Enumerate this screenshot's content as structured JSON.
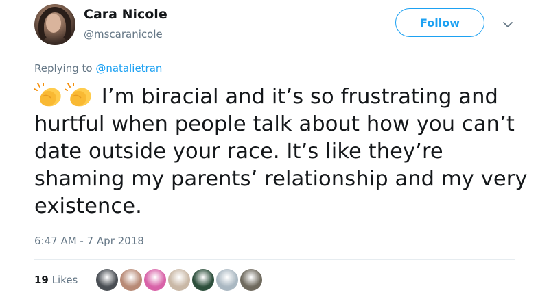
{
  "author": {
    "display_name": "Cara Nicole",
    "handle": "@mscaranicole",
    "avatar_icon": "profile-photo"
  },
  "follow_label": "Follow",
  "caret_icon": "chevron-down-icon",
  "reply": {
    "prefix": "Replying to ",
    "to_handle": "@natalietran"
  },
  "tweet": {
    "emoji": [
      "clapping-hands-emoji",
      "clapping-hands-emoji"
    ],
    "text": "I’m biracial and it’s so frustrating and hurtful when people talk about how you can’t date outside your race. It’s like they’re shaming my parents’ relationship and my very existence."
  },
  "timestamp": "6:47 AM - 7 Apr 2018",
  "likes": {
    "count": "19",
    "label": "Likes"
  },
  "likers": [
    {
      "name": "liker-avatar-1",
      "color": "#4a4f55"
    },
    {
      "name": "liker-avatar-2",
      "color": "#b88a76"
    },
    {
      "name": "liker-avatar-3",
      "color": "#d862a8"
    },
    {
      "name": "liker-avatar-4",
      "color": "#c9b8a6"
    },
    {
      "name": "liker-avatar-5",
      "color": "#2d4f3c"
    },
    {
      "name": "liker-avatar-6",
      "color": "#aab8c2"
    },
    {
      "name": "liker-avatar-7",
      "color": "#6f6a5e"
    }
  ],
  "colors": {
    "accent": "#1da1f2",
    "muted": "#657786",
    "text": "#14171a",
    "divider": "#e6ecf0"
  }
}
